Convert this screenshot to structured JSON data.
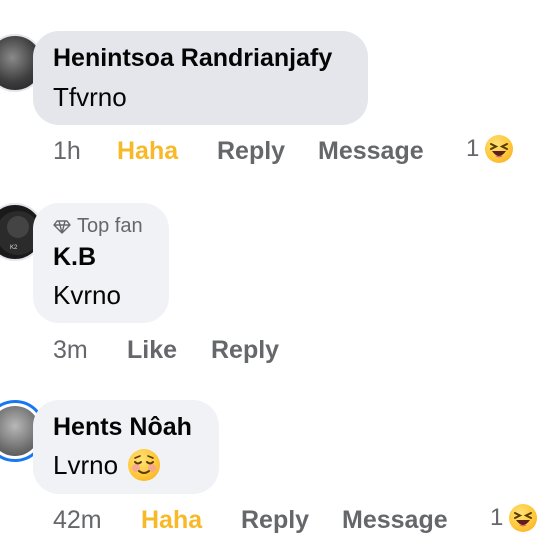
{
  "comments": [
    {
      "author": "Henintsoa Randrianjafy",
      "text": "Tfvrno",
      "time": "1h",
      "reaction_label": "Haha",
      "reply_label": "Reply",
      "message_label": "Message",
      "reaction_count": "1"
    },
    {
      "badge": "Top fan",
      "author": "K.B",
      "text": "Kvrno",
      "time": "3m",
      "like_label": "Like",
      "reply_label": "Reply"
    },
    {
      "author": "Hents Nôah",
      "text": "Lvrno",
      "time": "42m",
      "reaction_label": "Haha",
      "reply_label": "Reply",
      "message_label": "Message",
      "reaction_count": "1"
    }
  ],
  "colors": {
    "bubble": "#f0f2f5",
    "meta": "#65676b",
    "haha": "#f7b928",
    "story_ring": "#1877f2"
  },
  "icons": [
    "diamond-icon",
    "haha-emoji-icon",
    "relieved-emoji-icon"
  ]
}
